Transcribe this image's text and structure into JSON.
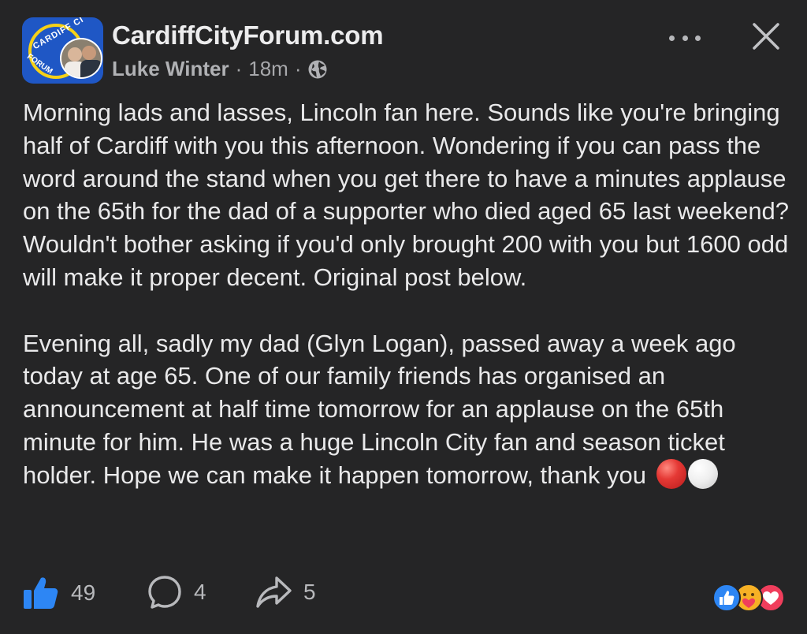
{
  "header": {
    "page_name": "CardiffCityForum.com",
    "author": "Luke Winter",
    "separator": "·",
    "time": "18m",
    "avatar_text_top": "CARDIFF CI",
    "avatar_text_bottom": "FORUM",
    "visibility_icon": "globe-icon",
    "more_icon": "more-horizontal-icon",
    "close_icon": "close-icon"
  },
  "post": {
    "paragraph1": "Morning lads and lasses, Lincoln fan here. Sounds like you're bringing half of Cardiff with you this afternoon. Wondering if you can pass the word around the stand when you get there to have a minutes applause on the 65th for the dad of a supporter who died aged 65 last weekend? Wouldn't bother asking if you'd only brought 200 with you but 1600 odd will make it proper decent. Original post below.",
    "paragraph2": "Evening all, sadly my dad (Glyn Logan), passed away a week ago today at age 65. One of our family friends has organised an announcement at half time tomorrow for an applause on the 65th minute for him. He was a huge Lincoln City fan and season ticket holder. Hope we can make it happen tomorrow, thank you"
  },
  "footer": {
    "likes": "49",
    "comments": "4",
    "shares": "5",
    "like_icon": "thumbs-up-icon",
    "comment_icon": "comment-icon",
    "share_icon": "share-icon",
    "reaction_icons": [
      "like-reaction-icon",
      "care-reaction-icon",
      "love-reaction-icon"
    ]
  },
  "colors": {
    "background": "#252526",
    "like_blue": "#2d86f4",
    "love_red": "#f03e5c",
    "care_yellow": "#f7b125"
  }
}
